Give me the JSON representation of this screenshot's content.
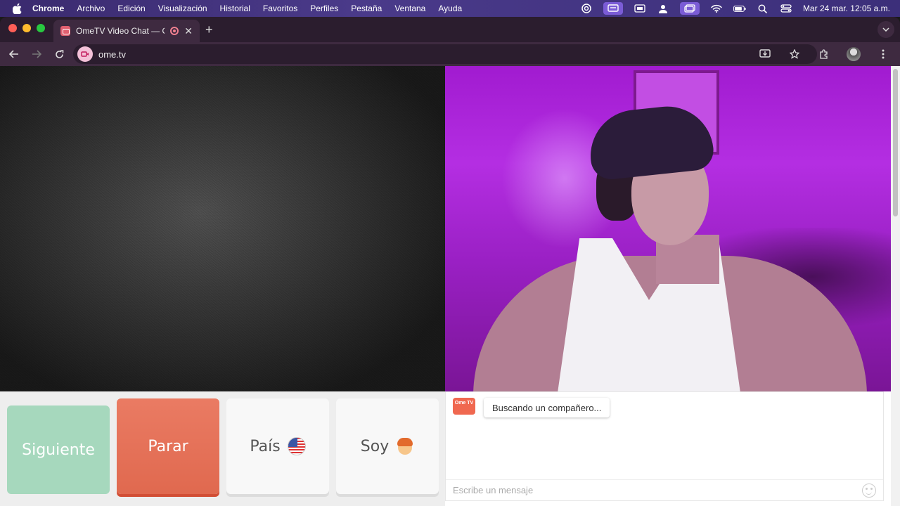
{
  "menubar": {
    "app": "Chrome",
    "items": [
      "Archivo",
      "Edición",
      "Visualización",
      "Historial",
      "Favoritos",
      "Perfiles",
      "Pestaña",
      "Ventana",
      "Ayuda"
    ],
    "clock": "Mar 24 mar.  12:05 a.m.",
    "status_icons": [
      "creative-cloud-icon",
      "screen-mirror-icon",
      "display-icon",
      "user-icon",
      "window-icon",
      "wifi-icon",
      "battery-icon",
      "spotlight-search-icon",
      "control-center-icon"
    ]
  },
  "browser": {
    "tab_title": "OmeTV Video Chat — Om",
    "url": "ome.tv",
    "new_tab": "+",
    "tab_close": "✕"
  },
  "page": {
    "buttons": {
      "next": "Siguiente",
      "stop": "Parar",
      "country": "País",
      "gender": "Soy"
    },
    "chat": {
      "logo": "Ome TV",
      "status": "Buscando un compañero...",
      "input_placeholder": "Escribe un mensaje"
    }
  },
  "colors": {
    "stop": "#e56e54",
    "next": "#a6d8bd",
    "webcam_bg": "#a11bd0"
  }
}
